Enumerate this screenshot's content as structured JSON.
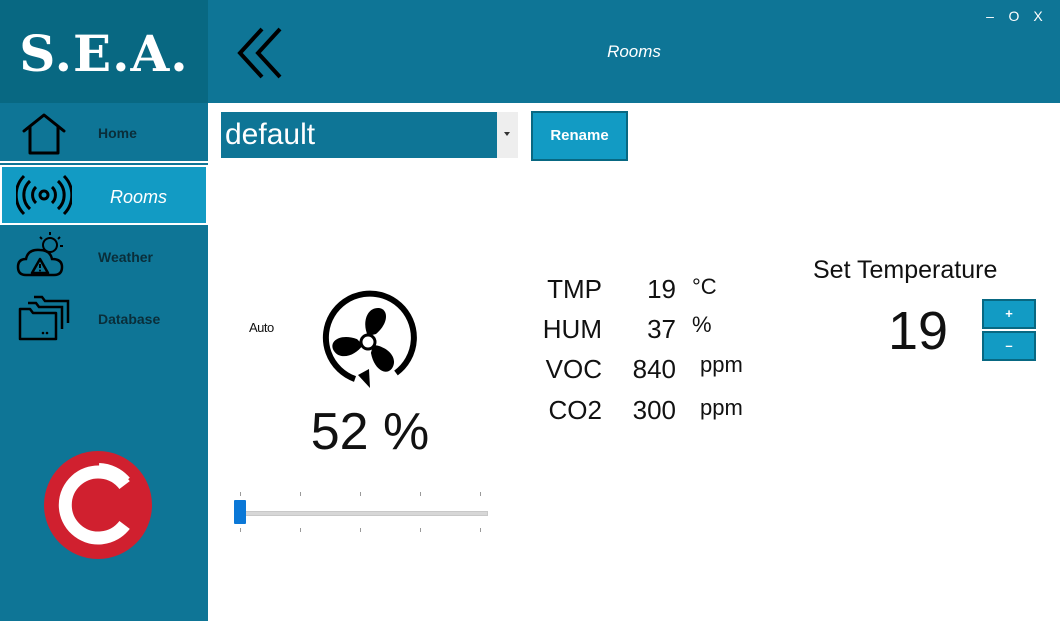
{
  "app": {
    "logo": "S.E.A.",
    "title": "Rooms"
  },
  "window_controls": {
    "minimize": "–",
    "maximize": "O",
    "close": "X"
  },
  "sidebar": {
    "items": [
      {
        "label": "Home",
        "icon": "home-icon"
      },
      {
        "label": "Rooms",
        "icon": "broadcast-icon",
        "active": true
      },
      {
        "label": "Weather",
        "icon": "weather-warning-icon"
      },
      {
        "label": "Database",
        "icon": "folders-icon"
      }
    ]
  },
  "room": {
    "selected": "default",
    "rename_label": "Rename"
  },
  "fan": {
    "mode": "Auto",
    "speed_text": "52 %",
    "slider_fraction": 0.0
  },
  "readings": [
    {
      "name": "TMP",
      "value": "19",
      "unit": "°C"
    },
    {
      "name": "HUM",
      "value": "37",
      "unit": "%"
    },
    {
      "name": "VOC",
      "value": "840",
      "unit": "ppm"
    },
    {
      "name": "CO2",
      "value": "300",
      "unit": "ppm"
    }
  ],
  "set_temperature": {
    "label": "Set Temperature",
    "value": "19",
    "plus": "+",
    "minus": "–"
  },
  "colors": {
    "primary": "#0e7596",
    "accent": "#129bc4",
    "dark": "#086882",
    "brand_red": "#d0202f"
  }
}
